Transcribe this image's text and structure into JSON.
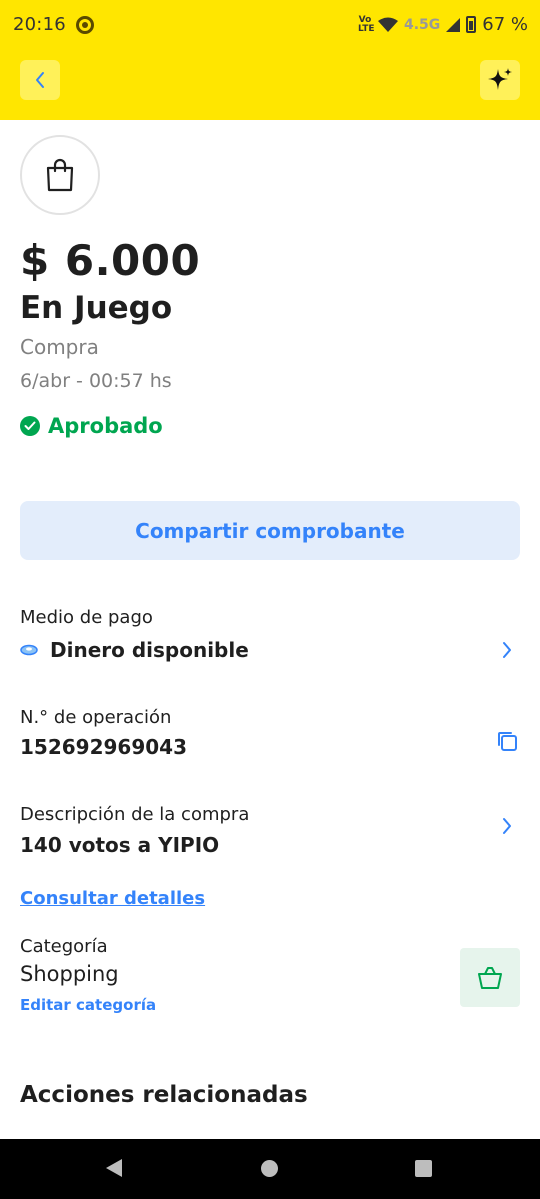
{
  "status_bar": {
    "time": "20:16",
    "network_label": "4.5G",
    "volte": "Vo LTE",
    "battery": "67 %"
  },
  "header": {
    "back_icon": "chevron-left-icon",
    "assistant_icon": "sparkle-icon"
  },
  "transaction": {
    "icon": "shopping-bag-icon",
    "amount": "$ 6.000",
    "merchant": "En Juego",
    "type": "Compra",
    "date": "6/abr - 00:57 hs",
    "status": "Aprobado"
  },
  "actions": {
    "share_label": "Compartir comprobante"
  },
  "payment": {
    "label": "Medio de pago",
    "value": "Dinero disponible"
  },
  "operation": {
    "label": "N.° de operación",
    "value": "152692969043"
  },
  "description": {
    "label": "Descripción de la compra",
    "value": "140 votos a YIPIO"
  },
  "details_link": "Consultar detalles",
  "category": {
    "label": "Categoría",
    "value": "Shopping",
    "edit_label": "Editar categoría"
  },
  "related": {
    "title": "Acciones relacionadas"
  },
  "colors": {
    "header_bg": "#FFE600",
    "accent_blue": "#3483FA",
    "success_green": "#00A650"
  }
}
